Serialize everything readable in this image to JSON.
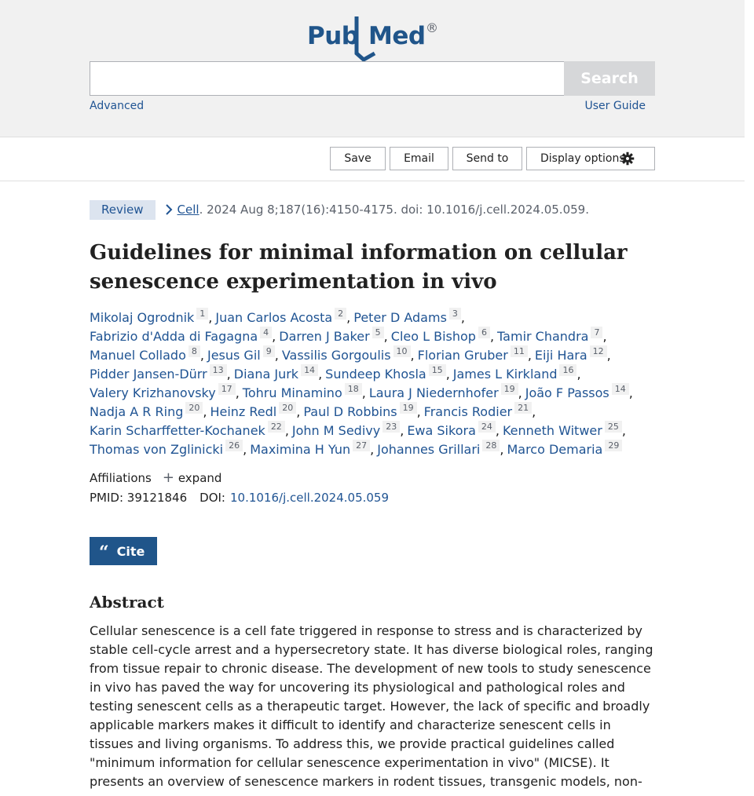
{
  "header": {
    "logo": {
      "pub": "Pub",
      "med": "Med",
      "registered": "®"
    },
    "search_value": "",
    "search_label": "Search",
    "advanced": "Advanced",
    "user_guide": "User Guide"
  },
  "actions": {
    "save": "Save",
    "email": "Email",
    "send_to": "Send to",
    "display_options": "Display options"
  },
  "citation": {
    "badge": "Review",
    "journal": "Cell",
    "details": ". 2024 Aug 8;187(16):4150-4175. doi: 10.1016/j.cell.2024.05.059."
  },
  "title_lines": [
    "Guidelines for minimal information on cellular",
    "senescence experimentation in vivo"
  ],
  "author_lines": [
    [
      {
        "name": "Mikolaj Ogrodnik",
        "aff": "1"
      },
      {
        "name": "Juan Carlos Acosta",
        "aff": "2"
      },
      {
        "name": "Peter D Adams",
        "aff": "3"
      }
    ],
    [
      {
        "name": "Fabrizio d'Adda di Fagagna",
        "aff": "4"
      },
      {
        "name": "Darren J Baker",
        "aff": "5"
      },
      {
        "name": "Cleo L Bishop",
        "aff": "6"
      },
      {
        "name": "Tamir Chandra",
        "aff": "7"
      }
    ],
    [
      {
        "name": "Manuel Collado",
        "aff": "8"
      },
      {
        "name": "Jesus Gil",
        "aff": "9"
      },
      {
        "name": "Vassilis Gorgoulis",
        "aff": "10"
      },
      {
        "name": "Florian Gruber",
        "aff": "11"
      },
      {
        "name": "Eiji Hara",
        "aff": "12"
      }
    ],
    [
      {
        "name": "Pidder Jansen-Dürr",
        "aff": "13"
      },
      {
        "name": "Diana Jurk",
        "aff": "14"
      },
      {
        "name": "Sundeep Khosla",
        "aff": "15"
      },
      {
        "name": "James L Kirkland",
        "aff": "16"
      }
    ],
    [
      {
        "name": "Valery Krizhanovsky",
        "aff": "17"
      },
      {
        "name": "Tohru Minamino",
        "aff": "18"
      },
      {
        "name": "Laura J Niedernhofer",
        "aff": "19"
      },
      {
        "name": "João F Passos",
        "aff": "14"
      }
    ],
    [
      {
        "name": "Nadja A R Ring",
        "aff": "20"
      },
      {
        "name": "Heinz Redl",
        "aff": "20"
      },
      {
        "name": "Paul D Robbins",
        "aff": "19"
      },
      {
        "name": "Francis Rodier",
        "aff": "21"
      }
    ],
    [
      {
        "name": "Karin Scharffetter-Kochanek",
        "aff": "22"
      },
      {
        "name": "John M Sedivy",
        "aff": "23"
      },
      {
        "name": "Ewa Sikora",
        "aff": "24"
      },
      {
        "name": "Kenneth Witwer",
        "aff": "25"
      }
    ],
    [
      {
        "name": "Thomas von Zglinicki",
        "aff": "26"
      },
      {
        "name": "Maximina H Yun",
        "aff": "27"
      },
      {
        "name": "Johannes Grillari",
        "aff": "28"
      },
      {
        "name": "Marco Demaria",
        "aff": "29"
      }
    ]
  ],
  "affiliations": {
    "label": "Affiliations",
    "plus": "+",
    "expand": "expand"
  },
  "ids": {
    "pmid": "PMID: 39121846",
    "doi_label": "DOI:",
    "doi": "10.1016/j.cell.2024.05.059"
  },
  "cite": {
    "icon": "“",
    "label": "Cite"
  },
  "abstract": {
    "heading": "Abstract",
    "lines": [
      "Cellular senescence is a cell fate triggered in response to stress and is characterized by",
      "stable cell-cycle arrest and a hypersecretory state. It has diverse biological roles, ranging",
      "from tissue repair to chronic disease. The development of new tools to study senescence",
      "in vivo has paved the way for uncovering its physiological and pathological roles and",
      "testing senescent cells as a therapeutic target. However, the lack of specific and broadly",
      "applicable markers makes it difficult to identify and characterize senescent cells in",
      "tissues and living organisms. To address this, we provide practical guidelines called",
      "\"minimum information for cellular senescence experimentation in vivo\" (MICSE). It",
      "presents an overview of senescence markers in rodent tissues, transgenic models, non-"
    ]
  },
  "colors": {
    "link": "#205493",
    "logo": "#20558a",
    "header_bg": "#f1f1f1",
    "badge_bg": "#dce4ef"
  }
}
